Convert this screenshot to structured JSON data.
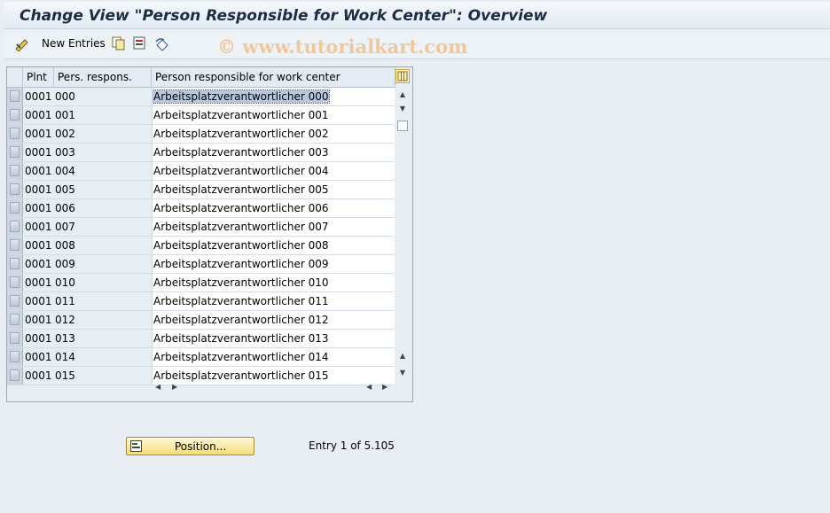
{
  "window": {
    "title": "Change View \"Person Responsible for Work Center\": Overview"
  },
  "toolbar": {
    "new_entries_label": "New Entries"
  },
  "watermark": "© www.tutorialkart.com",
  "table": {
    "columns": [
      "Plnt",
      "Pers. respons.",
      "Person responsible for work center"
    ],
    "rows": [
      {
        "plnt": "0001",
        "pers": "000",
        "desc": "Arbeitsplatzverantwortlicher 000"
      },
      {
        "plnt": "0001",
        "pers": "001",
        "desc": "Arbeitsplatzverantwortlicher 001"
      },
      {
        "plnt": "0001",
        "pers": "002",
        "desc": "Arbeitsplatzverantwortlicher 002"
      },
      {
        "plnt": "0001",
        "pers": "003",
        "desc": "Arbeitsplatzverantwortlicher 003"
      },
      {
        "plnt": "0001",
        "pers": "004",
        "desc": "Arbeitsplatzverantwortlicher 004"
      },
      {
        "plnt": "0001",
        "pers": "005",
        "desc": "Arbeitsplatzverantwortlicher 005"
      },
      {
        "plnt": "0001",
        "pers": "006",
        "desc": "Arbeitsplatzverantwortlicher 006"
      },
      {
        "plnt": "0001",
        "pers": "007",
        "desc": "Arbeitsplatzverantwortlicher 007"
      },
      {
        "plnt": "0001",
        "pers": "008",
        "desc": "Arbeitsplatzverantwortlicher 008"
      },
      {
        "plnt": "0001",
        "pers": "009",
        "desc": "Arbeitsplatzverantwortlicher 009"
      },
      {
        "plnt": "0001",
        "pers": "010",
        "desc": "Arbeitsplatzverantwortlicher 010"
      },
      {
        "plnt": "0001",
        "pers": "011",
        "desc": "Arbeitsplatzverantwortlicher 011"
      },
      {
        "plnt": "0001",
        "pers": "012",
        "desc": "Arbeitsplatzverantwortlicher 012"
      },
      {
        "plnt": "0001",
        "pers": "013",
        "desc": "Arbeitsplatzverantwortlicher 013"
      },
      {
        "plnt": "0001",
        "pers": "014",
        "desc": "Arbeitsplatzverantwortlicher 014"
      },
      {
        "plnt": "0001",
        "pers": "015",
        "desc": "Arbeitsplatzverantwortlicher 015"
      }
    ]
  },
  "footer": {
    "position_button_label": "Position...",
    "entry_info": "Entry 1 of 5.105"
  },
  "colors": {
    "accent_highlight": "#b6c8e0",
    "button_yellow": "#f2dc7a",
    "watermark": "#f0c79a"
  }
}
